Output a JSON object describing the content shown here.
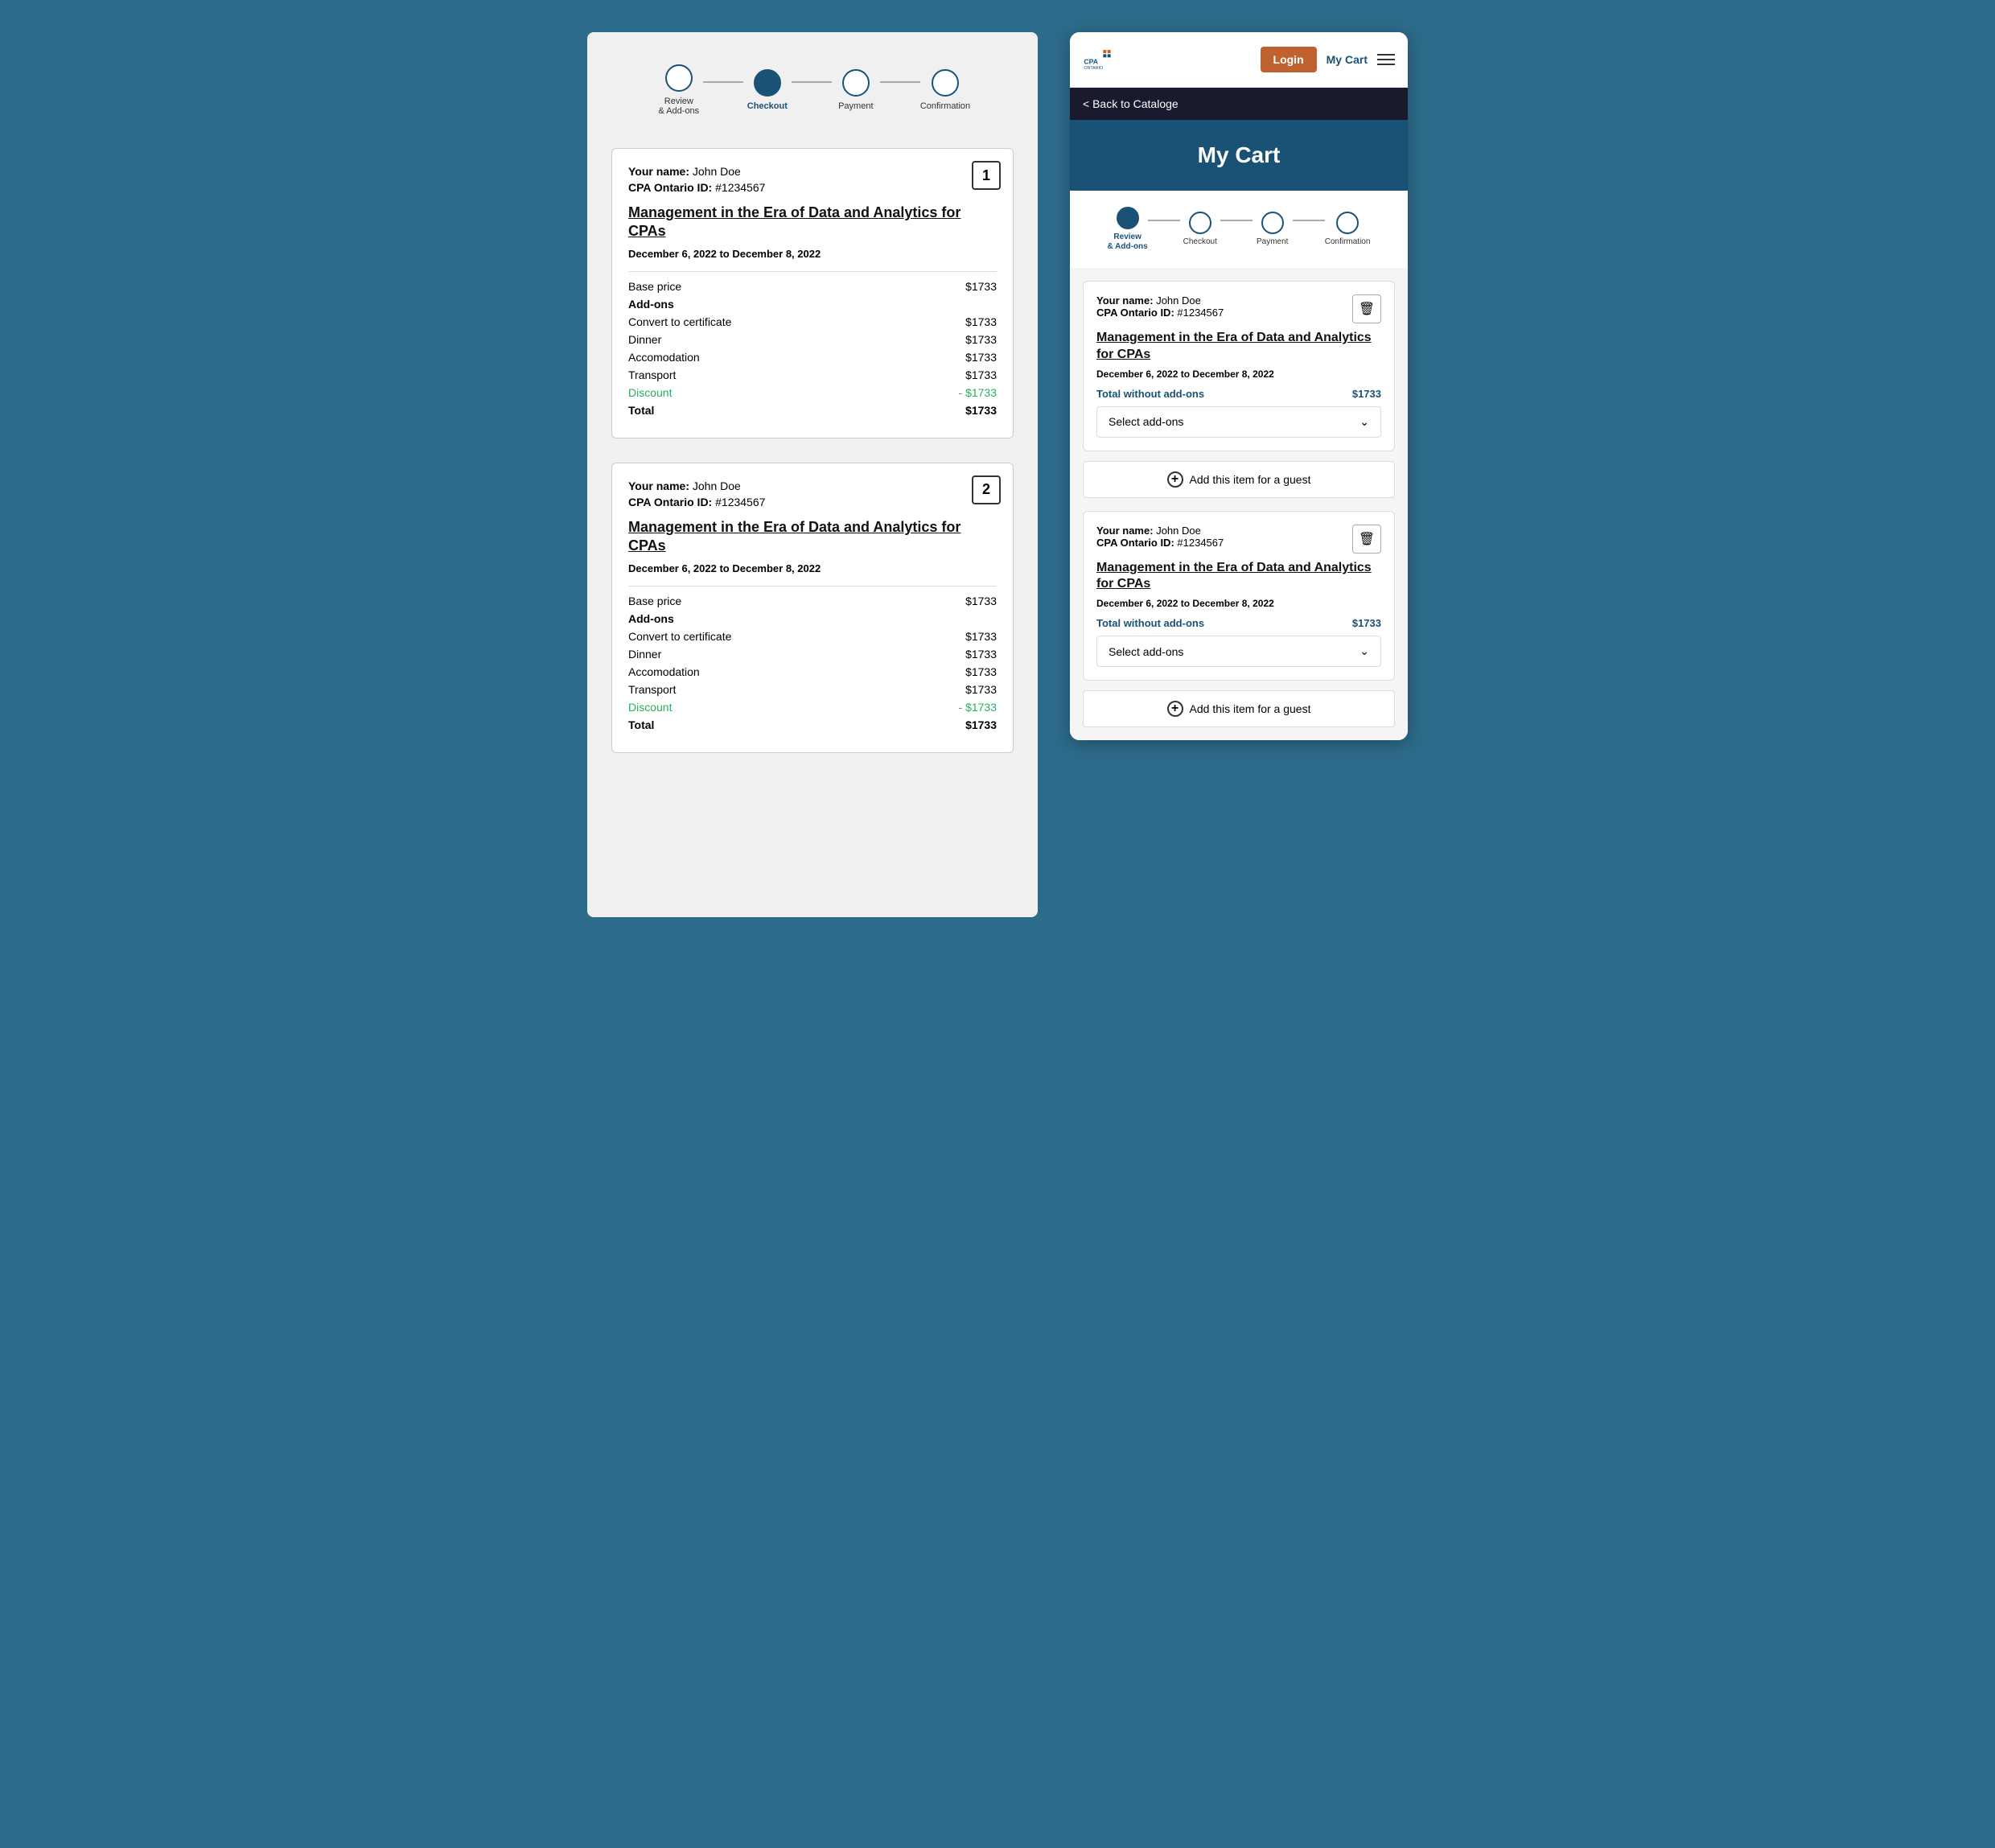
{
  "leftPanel": {
    "stepper": {
      "steps": [
        {
          "label": "Review\n& Add-ons",
          "active": false
        },
        {
          "label": "Checkout",
          "active": true
        },
        {
          "label": "Payment",
          "active": false
        },
        {
          "label": "Confirmation",
          "active": false
        }
      ]
    },
    "items": [
      {
        "number": "1",
        "yourName_label": "Your name:",
        "yourName_value": "John Doe",
        "cpaId_label": "CPA Ontario ID:",
        "cpaId_value": "#1234567",
        "title": "Management in the Era of Data and Analytics for CPAs",
        "date": "December 6, 2022 to December 8, 2022",
        "basePrice_label": "Base price",
        "basePrice_value": "$1733",
        "addons_label": "Add-ons",
        "rows": [
          {
            "label": "Convert to certificate",
            "value": "$1733"
          },
          {
            "label": "Dinner",
            "value": "$1733"
          },
          {
            "label": "Accomodation",
            "value": "$1733"
          },
          {
            "label": "Transport",
            "value": "$1733"
          }
        ],
        "discount_label": "Discount",
        "discount_value": "- $1733",
        "total_label": "Total",
        "total_value": "$1733"
      },
      {
        "number": "2",
        "yourName_label": "Your name:",
        "yourName_value": "John Doe",
        "cpaId_label": "CPA Ontario ID:",
        "cpaId_value": "#1234567",
        "title": "Management in the Era of Data and Analytics for CPAs",
        "date": "December 6, 2022 to December 8, 2022",
        "basePrice_label": "Base price",
        "basePrice_value": "$1733",
        "addons_label": "Add-ons",
        "rows": [
          {
            "label": "Convert to certificate",
            "value": "$1733"
          },
          {
            "label": "Dinner",
            "value": "$1733"
          },
          {
            "label": "Accomodation",
            "value": "$1733"
          },
          {
            "label": "Transport",
            "value": "$1733"
          }
        ],
        "discount_label": "Discount",
        "discount_value": "- $1733",
        "total_label": "Total",
        "total_value": "$1733"
      }
    ]
  },
  "rightPanel": {
    "header": {
      "login_label": "Login",
      "myCart_label": "My Cart"
    },
    "backNav": {
      "label": "< Back to Cataloge"
    },
    "myCartTitle": "My Cart",
    "stepper": {
      "steps": [
        {
          "label": "Review\n& Add-ons",
          "active": true
        },
        {
          "label": "Checkout",
          "active": false
        },
        {
          "label": "Payment",
          "active": false
        },
        {
          "label": "Confirmation",
          "active": false
        }
      ]
    },
    "items": [
      {
        "yourName_label": "Your name:",
        "yourName_value": "John Doe",
        "cpaId_label": "CPA Ontario ID:",
        "cpaId_value": "#1234567",
        "title": "Management in the Era of Data and Analytics for CPAs",
        "date": "December 6, 2022 to December 8, 2022",
        "totalWithout_label": "Total without add-ons",
        "totalWithout_value": "$1733",
        "selectAddons_label": "Select add-ons",
        "addGuest_label": "Add this item for a guest"
      },
      {
        "yourName_label": "Your name:",
        "yourName_value": "John Doe",
        "cpaId_label": "CPA Ontario ID:",
        "cpaId_value": "#1234567",
        "title": "Management in the Era of Data and Analytics for CPAs",
        "date": "December 6, 2022 to December 8, 2022",
        "totalWithout_label": "Total without add-ons",
        "totalWithout_value": "$1733",
        "selectAddons_label": "Select add-ons",
        "addGuest_label": "Add this item for a guest"
      }
    ]
  }
}
